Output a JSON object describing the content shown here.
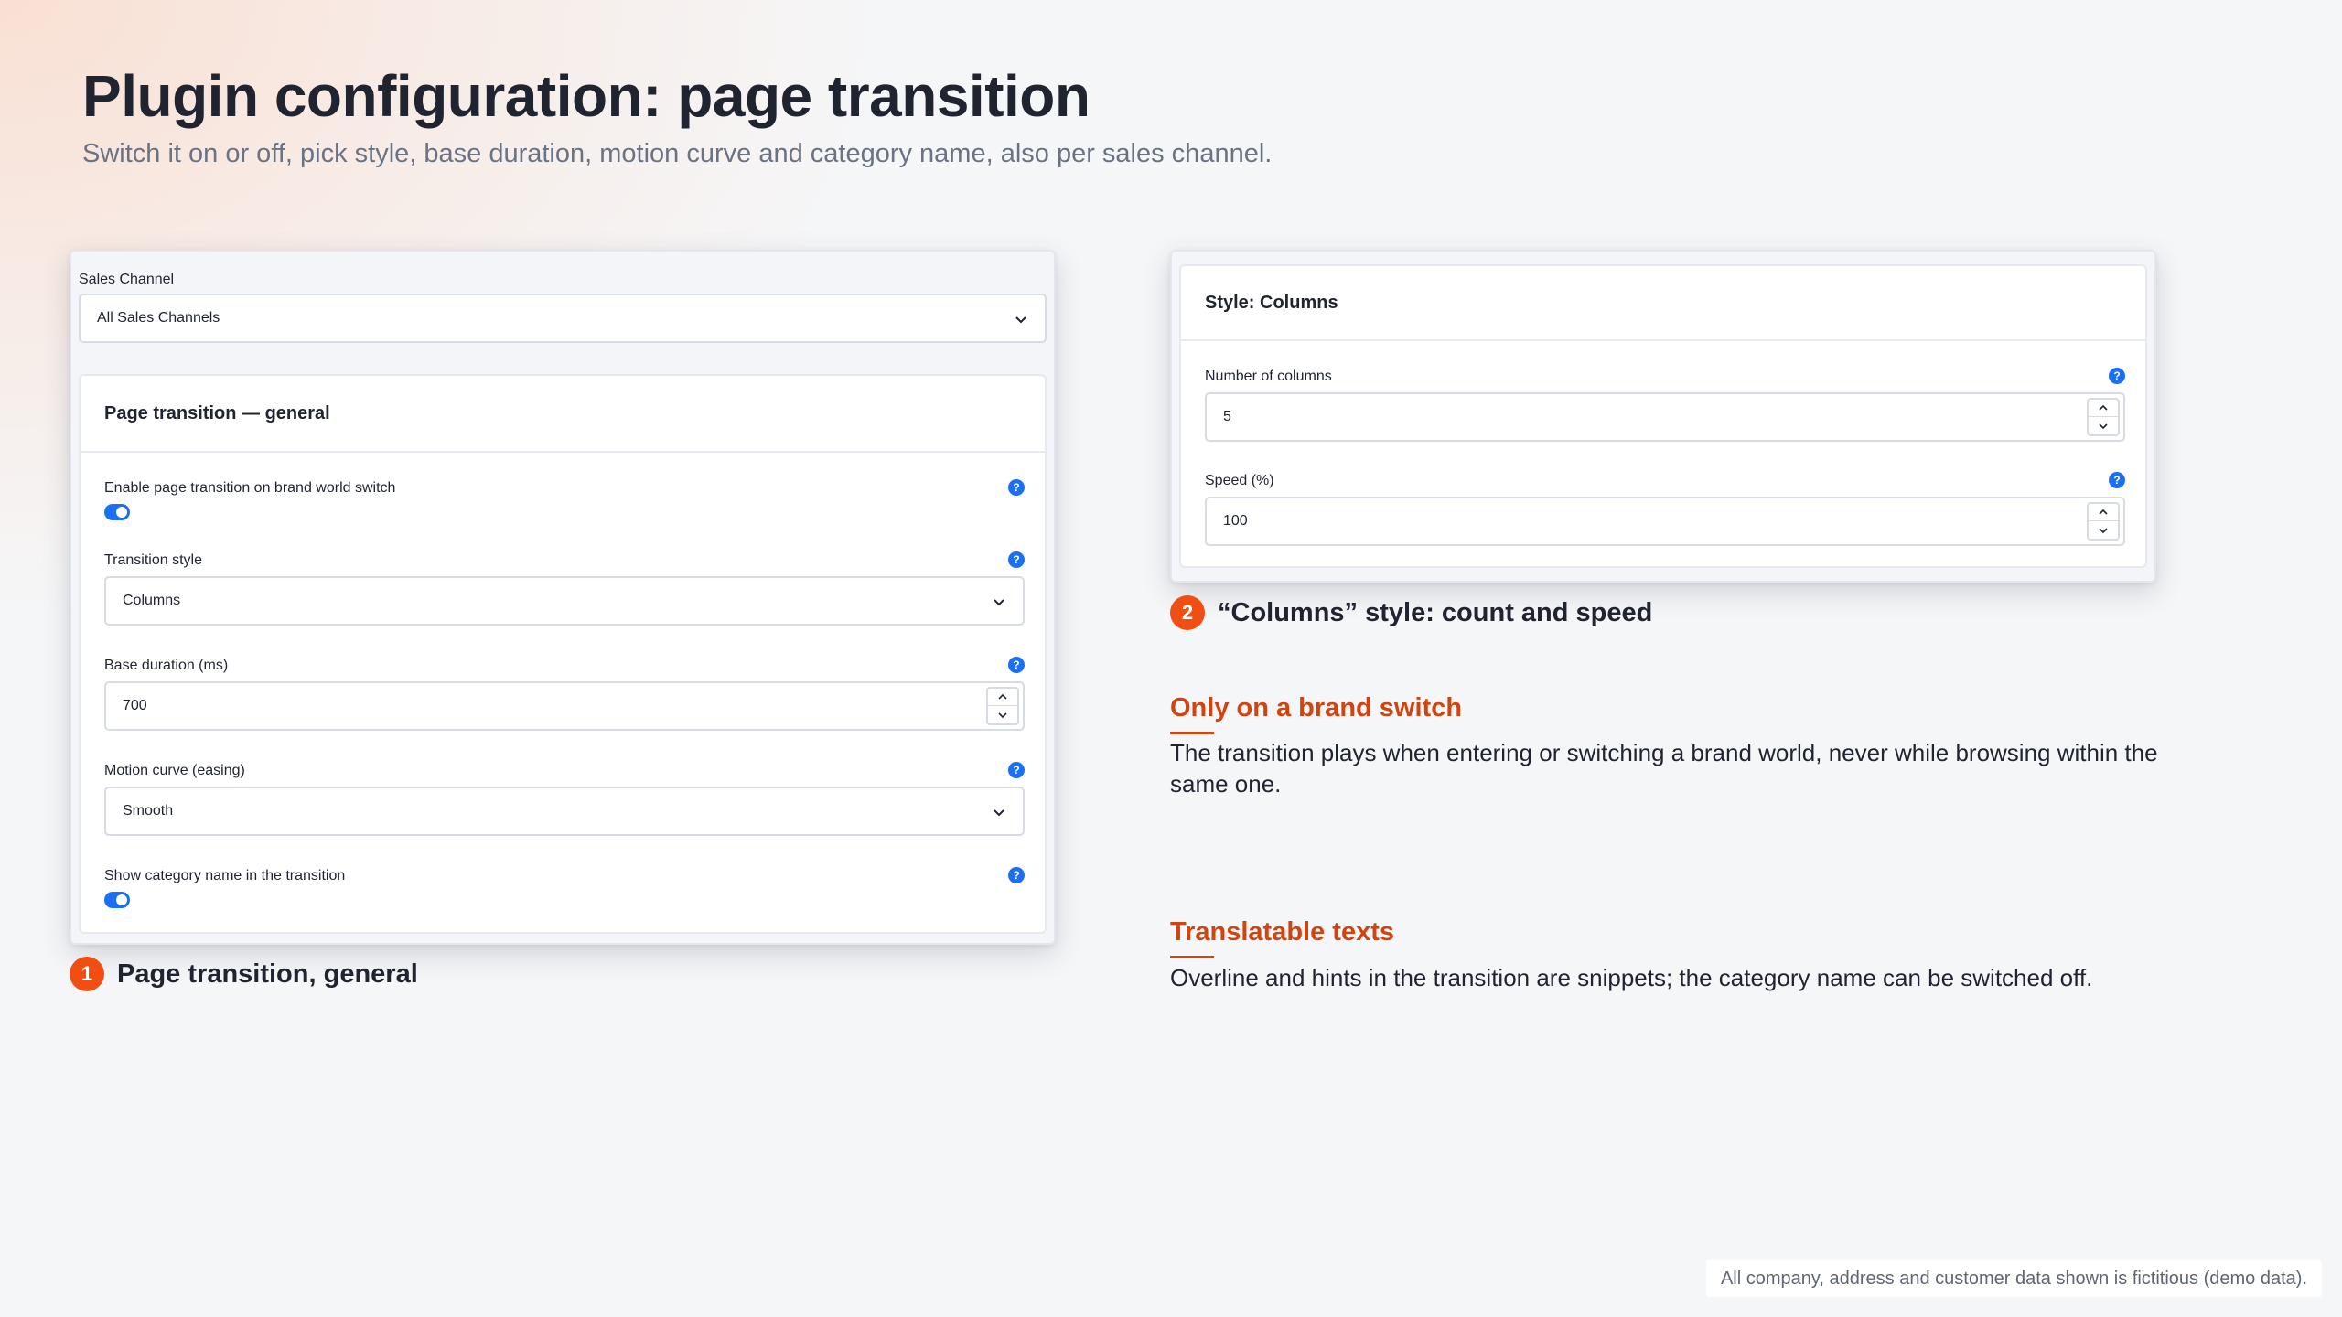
{
  "header": {
    "title": "Plugin configuration: page transition",
    "subtitle": "Switch it on or off, pick style, base duration, motion curve and category name, also per sales channel."
  },
  "panel_general": {
    "sales_channel_label": "Sales Channel",
    "sales_channel_value": "All Sales Channels",
    "card_title": "Page transition — general",
    "enable_label": "Enable page transition on brand world switch",
    "enable_on": true,
    "style_label": "Transition style",
    "style_value": "Columns",
    "duration_label": "Base duration (ms)",
    "duration_value": "700",
    "easing_label": "Motion curve (easing)",
    "easing_value": "Smooth",
    "category_label": "Show category name in the transition",
    "category_on": true,
    "help_glyph": "?"
  },
  "panel_columns": {
    "card_title": "Style: Columns",
    "columns_label": "Number of columns",
    "columns_value": "5",
    "speed_label": "Speed (%)",
    "speed_value": "100",
    "help_glyph": "?"
  },
  "captions": {
    "one_num": "1",
    "one_text": "Page transition, general",
    "two_num": "2",
    "two_text": "“Columns” style: count and speed"
  },
  "notes": [
    {
      "title": "Only on a brand switch",
      "text": "The transition plays when entering or switching a brand world, never while browsing within the same one."
    },
    {
      "title": "Translatable texts",
      "text": "Overline and hints in the transition are snippets; the category name can be switched off."
    }
  ],
  "footer": {
    "disclaimer": "All company, address and customer data shown is fictitious (demo data)."
  },
  "colors": {
    "accent_blue": "#1a6ff2",
    "accent_orange": "#f04e12",
    "note_title": "#d1440f"
  },
  "icons": [
    "chevron-down-icon",
    "help-icon",
    "spin-up-icon",
    "spin-down-icon"
  ]
}
